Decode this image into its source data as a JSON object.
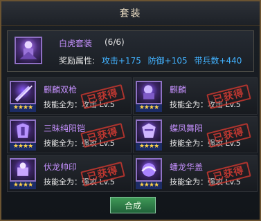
{
  "window": {
    "title": "套装"
  },
  "set": {
    "icon": "white-tiger-set-icon",
    "name": "白虎套装",
    "count": "(6/6)",
    "bonus_label": "奖励属性:",
    "bonuses": [
      "攻击+175",
      "防御+105",
      "带兵数+440"
    ]
  },
  "items": [
    {
      "name": "麒麟双枪",
      "effect": "技能全为：攻击 Lv.5",
      "stars": "★★★★",
      "stamp": "已获得",
      "icon": "dual-spear-icon"
    },
    {
      "name": "麒麟",
      "effect": "技能全为：攻击 Lv.5",
      "stars": "★★★★",
      "stamp": "已获得",
      "icon": "qilin-mount-icon"
    },
    {
      "name": "三昧纯阳铠",
      "effect": "技能全为：强攻 Lv.5",
      "stars": "★★★★",
      "stamp": "已获得",
      "icon": "armor-icon"
    },
    {
      "name": "蝶凤舞阳",
      "effect": "技能全为：强攻 Lv.5",
      "stars": "★★★★",
      "stamp": "已获得",
      "icon": "phoenix-armor-icon"
    },
    {
      "name": "伏龙帅印",
      "effect": "技能全为：强攻 Lv.5",
      "stars": "★★★★",
      "stamp": "已获得",
      "icon": "seal-icon"
    },
    {
      "name": "蟠龙华盖",
      "effect": "技能全为：强攻 Lv.5",
      "stars": "★★★★",
      "stamp": "已获得",
      "icon": "dragon-canopy-icon"
    }
  ],
  "actions": {
    "synthesize_label": "合成"
  },
  "colors": {
    "purple": "#c38ffb",
    "blue": "#42b2ff",
    "stamp_red": "#d83b32",
    "button_green": "#2f7a47"
  }
}
